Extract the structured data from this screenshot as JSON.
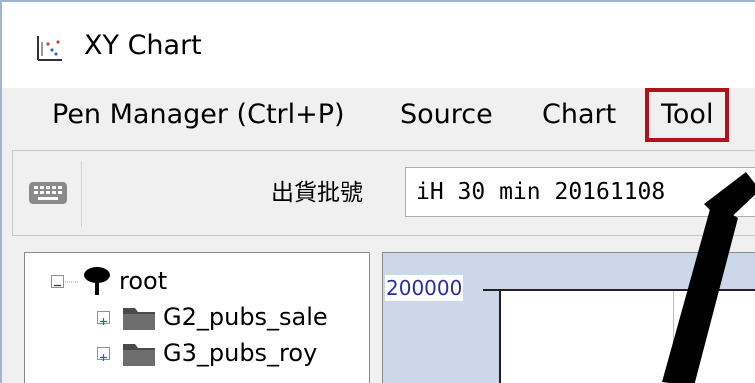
{
  "window": {
    "title": "XY Chart",
    "app_icon": "xy-chart-icon"
  },
  "menu": {
    "items": [
      {
        "label": "Pen Manager (Ctrl+P)"
      },
      {
        "label": "Source"
      },
      {
        "label": "Chart"
      },
      {
        "label": "Tool"
      }
    ],
    "highlighted": "Tool",
    "highlight_color": "#b0121b"
  },
  "toolbar": {
    "keyboard_icon": "keyboard-icon",
    "field_label": "出貨批號",
    "combo_value": "iH 30 min 20161108",
    "combo_icon": "chevron-down-icon"
  },
  "tree": {
    "root_label": "root",
    "root_icon": "tree-icon",
    "children": [
      {
        "label": "G2_pubs_sale",
        "icon": "folder-icon"
      },
      {
        "label": "G3_pubs_roy",
        "icon": "folder-icon"
      }
    ]
  },
  "chart": {
    "y_tick_label": "200000",
    "background": "#ccd8ea",
    "tick_label_color": "#2a2ab0"
  }
}
